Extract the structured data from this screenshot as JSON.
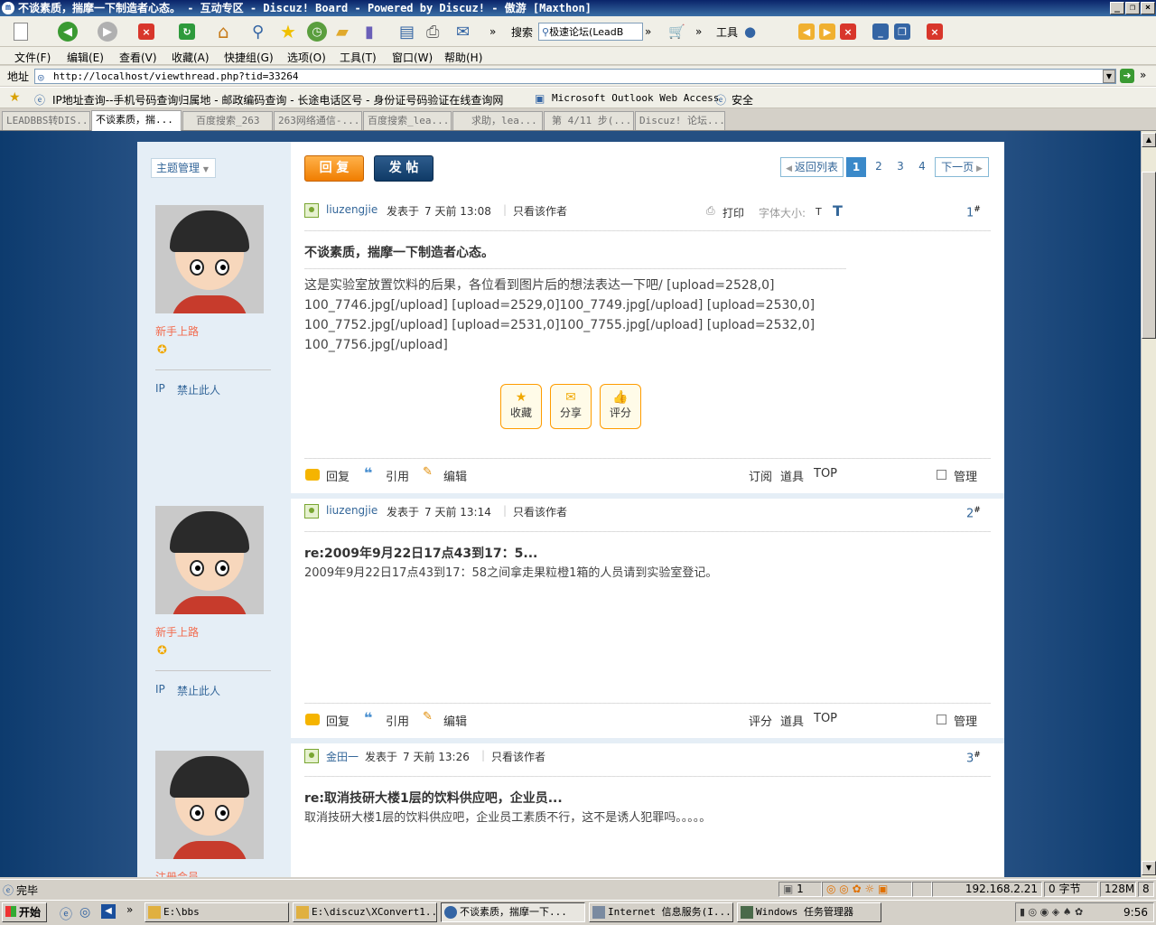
{
  "window": {
    "title": "不谈素质，揣摩一下制造者心态。 - 互动专区 - Discuz! Board - Powered by Discuz! - 傲游 [Maxthon]"
  },
  "toolbar": {
    "search_label": "搜索",
    "search_value": "极速论坛(LeadB",
    "tools_label": "工具"
  },
  "menu": [
    "文件(F)",
    "编辑(E)",
    "查看(V)",
    "收藏(A)",
    "快捷组(G)",
    "选项(O)",
    "工具(T)",
    "窗口(W)",
    "帮助(H)"
  ],
  "address": {
    "label": "地址",
    "url": "http://localhost/viewthread.php?tid=33264"
  },
  "favorites": [
    "IP地址查询--手机号码查询归属地 - 邮政编码查询 - 长途电话区号 - 身份证号码验证在线查询网",
    "Microsoft Outlook Web Access",
    "安全"
  ],
  "tabs": [
    "LEADBBS转DIS...",
    "不谈素质，揣...",
    "百度搜索_263",
    "263网络通信-...",
    "百度搜索_lea...",
    "求助，lea...",
    "第 4/11 步(...",
    "Discuz! 论坛..."
  ],
  "forum": {
    "topic_manage": "主题管理",
    "reply_btn": "回 复",
    "post_btn": "发 帖",
    "pager": {
      "back": "返回列表",
      "pages": [
        "1",
        "2",
        "3",
        "4"
      ],
      "next": "下一页"
    },
    "print": "打印",
    "font_size": "字体大小:",
    "fs_small": "T",
    "fs_big": "T",
    "actions": {
      "reply": "回复",
      "quote": "引用",
      "edit": "编辑",
      "subscribe": "订阅",
      "rate": "评分",
      "tools": "道具",
      "top": "TOP",
      "manage": "管理"
    },
    "share_buttons": {
      "fav": "收藏",
      "share": "分享",
      "rate": "评分"
    },
    "ip": "IP",
    "ban": "禁止此人",
    "posted": "发表于",
    "only_author": "只看该作者",
    "posts": [
      {
        "author": "liuzengjie",
        "time": "7 天前 13:08",
        "floor": "1",
        "rank": "新手上路",
        "title": "不谈素质，揣摩一下制造者心态。",
        "body": "这是实验室放置饮料的后果，各位看到图片后的想法表达一下吧/ [upload=2528,0] 100_7746.jpg[/upload] [upload=2529,0]100_7749.jpg[/upload] [upload=2530,0] 100_7752.jpg[/upload] [upload=2531,0]100_7755.jpg[/upload] [upload=2532,0] 100_7756.jpg[/upload]"
      },
      {
        "author": "liuzengjie",
        "time": "7 天前 13:14",
        "floor": "2",
        "rank": "新手上路",
        "title": "re:2009年9月22日17点43到17：5...",
        "body": "2009年9月22日17点43到17：58之间拿走果粒橙1箱的人员请到实验室登记。"
      },
      {
        "author": "金田一",
        "time": "7 天前 13:26",
        "floor": "3",
        "rank": "注册会员",
        "title": "re:取消技研大楼1层的饮料供应吧，企业员...",
        "body": "取消技研大楼1层的饮料供应吧，企业员工素质不行，这不是诱人犯罪吗。。。。。"
      }
    ]
  },
  "statusbar": {
    "text": "完毕",
    "count": "1",
    "ip": "192.168.2.21",
    "bytes": "0 字节",
    "mem": "128M",
    "extra": "8"
  },
  "taskbar": {
    "start": "开始",
    "tasks": [
      "E:\\bbs",
      "E:\\discuz\\XConvert1...",
      "不谈素质，揣摩一下...",
      "Internet 信息服务(I...",
      "Windows 任务管理器"
    ],
    "clock": "9:56"
  },
  "colors": {
    "title": "#0a246a",
    "accent": "#336699",
    "orange": "#f07d00",
    "page_bg": "#244f82"
  }
}
